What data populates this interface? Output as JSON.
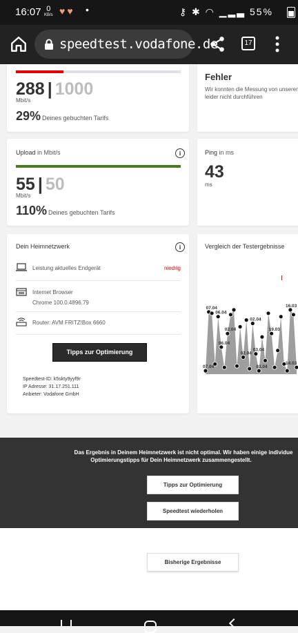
{
  "status": {
    "time": "16:07",
    "kbs_top": "0",
    "kbs_bottom": "KB/s",
    "battery": "55%"
  },
  "browser": {
    "url": "speedtest.vodafone.de",
    "tab_count": "17"
  },
  "download": {
    "value": "288",
    "max": "1000",
    "unit": "Mbit/s",
    "percent": "29%",
    "percent_label": "Deines gebuchten Tarifs",
    "ratio": 0.288
  },
  "error": {
    "title": "Fehler",
    "line1": "Wir konnten die Messung von unseren",
    "line2": "leider nicht durchführen"
  },
  "upload": {
    "title": "Upload",
    "title_unit": "in Mbit/s",
    "value": "55",
    "max": "50",
    "unit": "Mbit/s",
    "percent": "110%",
    "percent_label": "Deines gebuchten Tarifs",
    "ratio": 1.0
  },
  "ping": {
    "title": "Ping",
    "title_unit": "in ms",
    "value": "43",
    "unit": "ms"
  },
  "home_network": {
    "title": "Dein Heimnetzwerk",
    "device_label": "Leistung aktuelles Endgerät",
    "device_status": "niedrig",
    "browser_label": "Internet Browser",
    "browser_value": "Chrome 100.0.4896.79",
    "router_label": "Router: AVM FRITZ!Box 6660",
    "tips_button": "Tipps zur Optimierung",
    "speedtest_id": "Speedtest-ID: k5skty9yyf9r",
    "ip": "IP Adresse: 31.17.251.111",
    "provider": "Anbieter: Vodafone GmbH"
  },
  "comparison": {
    "title": "Vergleich der Testergebnisse"
  },
  "chart_data": {
    "type": "area",
    "title": "Vergleich der Testergebnisse",
    "point_labels": [
      "07.04",
      "07.04",
      "06.04",
      "06.04",
      "02.04",
      "02.04",
      "02.04",
      "03.04",
      "03.04",
      "16.03",
      "19.03",
      "14.03"
    ],
    "values": [
      5,
      92,
      90,
      15,
      85,
      40,
      10,
      60,
      88,
      95,
      12,
      70,
      25,
      80,
      8,
      75,
      30,
      5,
      55,
      20,
      90,
      60,
      10,
      35,
      85,
      15,
      5,
      95,
      88,
      10
    ]
  },
  "banner": {
    "line1": "Das Ergebnis in Deinem Heimnetzwerk ist nicht optimal. Wir haben einige individue",
    "line2": "Optimierungstipps für Dein Heimnetzwerk zusammengestellt.",
    "tips_button": "Tipps zur Optimierung",
    "repeat_button": "Speedtest wiederholen"
  },
  "history_button": "Bisherige Ergebnisse",
  "colors": {
    "download_bar": "#e60000",
    "upload_bar": "#4a7c1f",
    "status_red": "#e60000"
  }
}
